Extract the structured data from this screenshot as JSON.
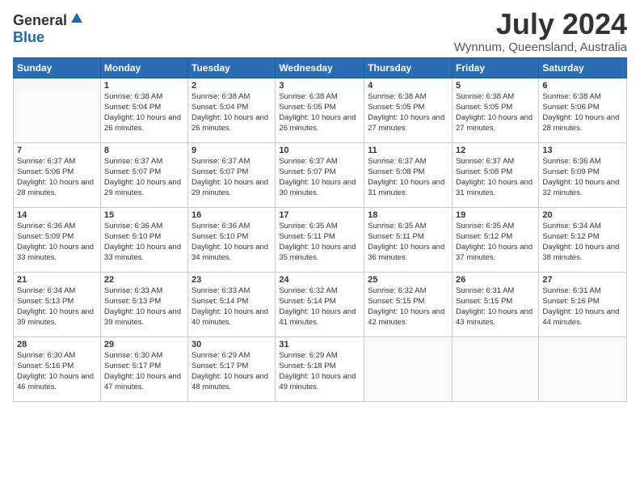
{
  "header": {
    "logo_general": "General",
    "logo_blue": "Blue",
    "month_year": "July 2024",
    "location": "Wynnum, Queensland, Australia"
  },
  "days_of_week": [
    "Sunday",
    "Monday",
    "Tuesday",
    "Wednesday",
    "Thursday",
    "Friday",
    "Saturday"
  ],
  "weeks": [
    [
      {
        "num": "",
        "sunrise": "",
        "sunset": "",
        "daylight": ""
      },
      {
        "num": "1",
        "sunrise": "Sunrise: 6:38 AM",
        "sunset": "Sunset: 5:04 PM",
        "daylight": "Daylight: 10 hours and 26 minutes."
      },
      {
        "num": "2",
        "sunrise": "Sunrise: 6:38 AM",
        "sunset": "Sunset: 5:04 PM",
        "daylight": "Daylight: 10 hours and 26 minutes."
      },
      {
        "num": "3",
        "sunrise": "Sunrise: 6:38 AM",
        "sunset": "Sunset: 5:05 PM",
        "daylight": "Daylight: 10 hours and 26 minutes."
      },
      {
        "num": "4",
        "sunrise": "Sunrise: 6:38 AM",
        "sunset": "Sunset: 5:05 PM",
        "daylight": "Daylight: 10 hours and 27 minutes."
      },
      {
        "num": "5",
        "sunrise": "Sunrise: 6:38 AM",
        "sunset": "Sunset: 5:05 PM",
        "daylight": "Daylight: 10 hours and 27 minutes."
      },
      {
        "num": "6",
        "sunrise": "Sunrise: 6:38 AM",
        "sunset": "Sunset: 5:06 PM",
        "daylight": "Daylight: 10 hours and 28 minutes."
      }
    ],
    [
      {
        "num": "7",
        "sunrise": "Sunrise: 6:37 AM",
        "sunset": "Sunset: 5:06 PM",
        "daylight": "Daylight: 10 hours and 28 minutes."
      },
      {
        "num": "8",
        "sunrise": "Sunrise: 6:37 AM",
        "sunset": "Sunset: 5:07 PM",
        "daylight": "Daylight: 10 hours and 29 minutes."
      },
      {
        "num": "9",
        "sunrise": "Sunrise: 6:37 AM",
        "sunset": "Sunset: 5:07 PM",
        "daylight": "Daylight: 10 hours and 29 minutes."
      },
      {
        "num": "10",
        "sunrise": "Sunrise: 6:37 AM",
        "sunset": "Sunset: 5:07 PM",
        "daylight": "Daylight: 10 hours and 30 minutes."
      },
      {
        "num": "11",
        "sunrise": "Sunrise: 6:37 AM",
        "sunset": "Sunset: 5:08 PM",
        "daylight": "Daylight: 10 hours and 31 minutes."
      },
      {
        "num": "12",
        "sunrise": "Sunrise: 6:37 AM",
        "sunset": "Sunset: 5:08 PM",
        "daylight": "Daylight: 10 hours and 31 minutes."
      },
      {
        "num": "13",
        "sunrise": "Sunrise: 6:36 AM",
        "sunset": "Sunset: 5:09 PM",
        "daylight": "Daylight: 10 hours and 32 minutes."
      }
    ],
    [
      {
        "num": "14",
        "sunrise": "Sunrise: 6:36 AM",
        "sunset": "Sunset: 5:09 PM",
        "daylight": "Daylight: 10 hours and 33 minutes."
      },
      {
        "num": "15",
        "sunrise": "Sunrise: 6:36 AM",
        "sunset": "Sunset: 5:10 PM",
        "daylight": "Daylight: 10 hours and 33 minutes."
      },
      {
        "num": "16",
        "sunrise": "Sunrise: 6:36 AM",
        "sunset": "Sunset: 5:10 PM",
        "daylight": "Daylight: 10 hours and 34 minutes."
      },
      {
        "num": "17",
        "sunrise": "Sunrise: 6:35 AM",
        "sunset": "Sunset: 5:11 PM",
        "daylight": "Daylight: 10 hours and 35 minutes."
      },
      {
        "num": "18",
        "sunrise": "Sunrise: 6:35 AM",
        "sunset": "Sunset: 5:11 PM",
        "daylight": "Daylight: 10 hours and 36 minutes."
      },
      {
        "num": "19",
        "sunrise": "Sunrise: 6:35 AM",
        "sunset": "Sunset: 5:12 PM",
        "daylight": "Daylight: 10 hours and 37 minutes."
      },
      {
        "num": "20",
        "sunrise": "Sunrise: 6:34 AM",
        "sunset": "Sunset: 5:12 PM",
        "daylight": "Daylight: 10 hours and 38 minutes."
      }
    ],
    [
      {
        "num": "21",
        "sunrise": "Sunrise: 6:34 AM",
        "sunset": "Sunset: 5:13 PM",
        "daylight": "Daylight: 10 hours and 39 minutes."
      },
      {
        "num": "22",
        "sunrise": "Sunrise: 6:33 AM",
        "sunset": "Sunset: 5:13 PM",
        "daylight": "Daylight: 10 hours and 39 minutes."
      },
      {
        "num": "23",
        "sunrise": "Sunrise: 6:33 AM",
        "sunset": "Sunset: 5:14 PM",
        "daylight": "Daylight: 10 hours and 40 minutes."
      },
      {
        "num": "24",
        "sunrise": "Sunrise: 6:32 AM",
        "sunset": "Sunset: 5:14 PM",
        "daylight": "Daylight: 10 hours and 41 minutes."
      },
      {
        "num": "25",
        "sunrise": "Sunrise: 6:32 AM",
        "sunset": "Sunset: 5:15 PM",
        "daylight": "Daylight: 10 hours and 42 minutes."
      },
      {
        "num": "26",
        "sunrise": "Sunrise: 6:31 AM",
        "sunset": "Sunset: 5:15 PM",
        "daylight": "Daylight: 10 hours and 43 minutes."
      },
      {
        "num": "27",
        "sunrise": "Sunrise: 6:31 AM",
        "sunset": "Sunset: 5:16 PM",
        "daylight": "Daylight: 10 hours and 44 minutes."
      }
    ],
    [
      {
        "num": "28",
        "sunrise": "Sunrise: 6:30 AM",
        "sunset": "Sunset: 5:16 PM",
        "daylight": "Daylight: 10 hours and 46 minutes."
      },
      {
        "num": "29",
        "sunrise": "Sunrise: 6:30 AM",
        "sunset": "Sunset: 5:17 PM",
        "daylight": "Daylight: 10 hours and 47 minutes."
      },
      {
        "num": "30",
        "sunrise": "Sunrise: 6:29 AM",
        "sunset": "Sunset: 5:17 PM",
        "daylight": "Daylight: 10 hours and 48 minutes."
      },
      {
        "num": "31",
        "sunrise": "Sunrise: 6:29 AM",
        "sunset": "Sunset: 5:18 PM",
        "daylight": "Daylight: 10 hours and 49 minutes."
      },
      {
        "num": "",
        "sunrise": "",
        "sunset": "",
        "daylight": ""
      },
      {
        "num": "",
        "sunrise": "",
        "sunset": "",
        "daylight": ""
      },
      {
        "num": "",
        "sunrise": "",
        "sunset": "",
        "daylight": ""
      }
    ]
  ]
}
